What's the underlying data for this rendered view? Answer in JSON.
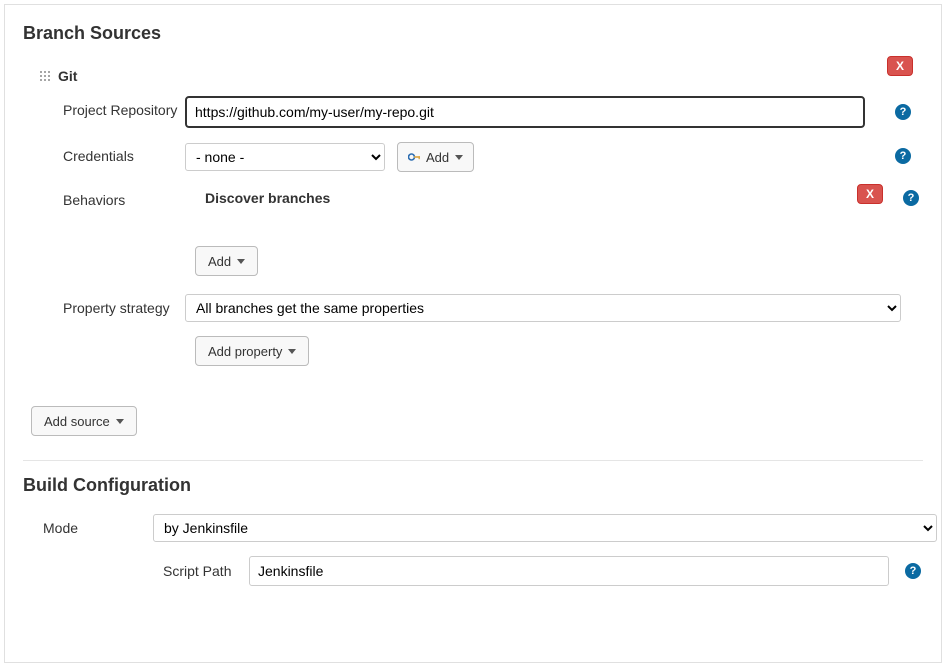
{
  "branchSources": {
    "title": "Branch Sources",
    "git": {
      "label": "Git",
      "deleteLabel": "X",
      "projectRepository": {
        "label": "Project Repository",
        "value": "https://github.com/my-user/my-repo.git"
      },
      "credentials": {
        "label": "Credentials",
        "selected": "- none -",
        "addButton": "Add"
      },
      "behaviors": {
        "label": "Behaviors",
        "discoverBranches": "Discover branches",
        "deleteLabel": "X",
        "addButton": "Add"
      },
      "propertyStrategy": {
        "label": "Property strategy",
        "selected": "All branches get the same properties",
        "addPropertyButton": "Add property"
      }
    },
    "addSourceButton": "Add source"
  },
  "buildConfiguration": {
    "title": "Build Configuration",
    "mode": {
      "label": "Mode",
      "selected": "by Jenkinsfile"
    },
    "scriptPath": {
      "label": "Script Path",
      "value": "Jenkinsfile"
    }
  },
  "icons": {
    "help": "?",
    "caret": ""
  }
}
